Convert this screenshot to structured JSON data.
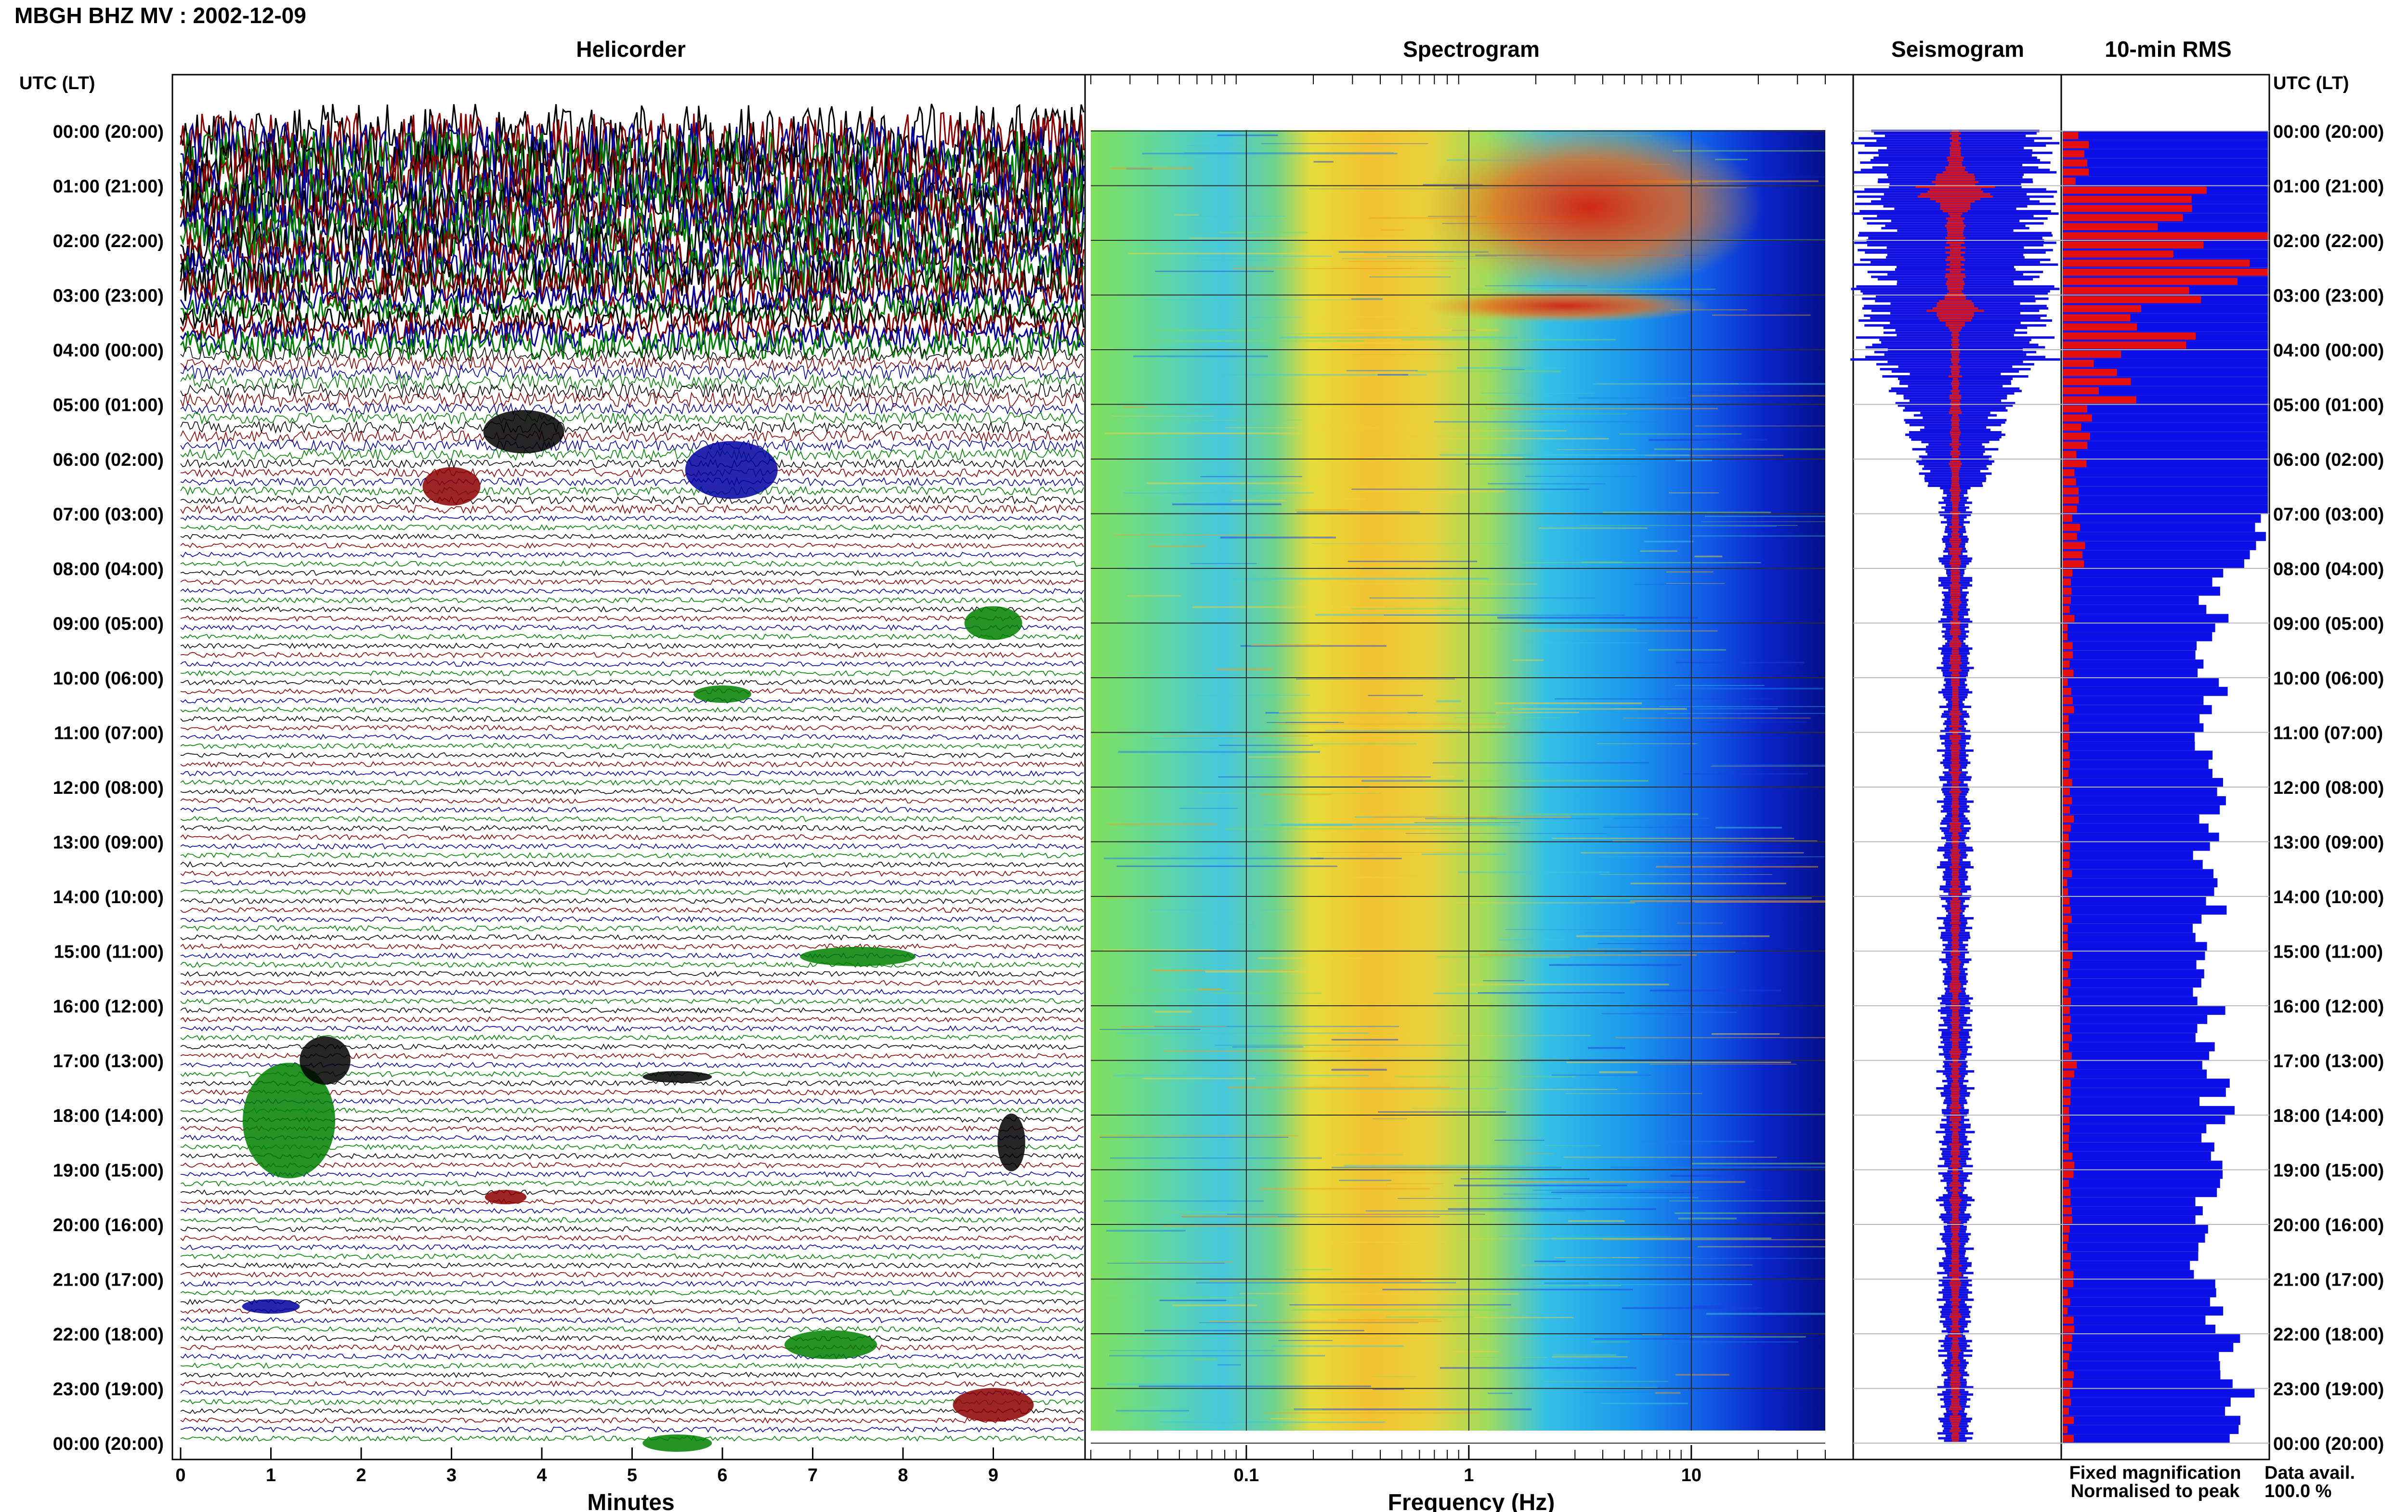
{
  "title": "MBGH BHZ MV : 2002-12-09",
  "panels": {
    "helicorder": "Helicorder",
    "spectrogram": "Spectrogram",
    "seismogram": "Seismogram",
    "rms": "10-min RMS"
  },
  "time_header": "UTC (LT)",
  "hours": [
    "00:00 (20:00)",
    "01:00 (21:00)",
    "02:00 (22:00)",
    "03:00 (23:00)",
    "04:00 (00:00)",
    "05:00 (01:00)",
    "06:00 (02:00)",
    "07:00 (03:00)",
    "08:00 (04:00)",
    "09:00 (05:00)",
    "10:00 (06:00)",
    "11:00 (07:00)",
    "12:00 (08:00)",
    "13:00 (09:00)",
    "14:00 (10:00)",
    "15:00 (11:00)",
    "16:00 (12:00)",
    "17:00 (13:00)",
    "18:00 (14:00)",
    "19:00 (15:00)",
    "20:00 (16:00)",
    "21:00 (17:00)",
    "22:00 (18:00)",
    "23:00 (19:00)",
    "00:00 (20:00)"
  ],
  "minutes_ticks": [
    "0",
    "1",
    "2",
    "3",
    "4",
    "5",
    "6",
    "7",
    "8",
    "9"
  ],
  "minutes_label": "Minutes",
  "frequency_ticks": [
    "0.1",
    "1",
    "10"
  ],
  "frequency_label": "Frequency (Hz)",
  "legend": {
    "fixed": "Fixed magnification",
    "normalised": "Normalised to peak",
    "fixed_color": "#1010e0",
    "normalised_color": "#e01010"
  },
  "availability": {
    "label": "Data avail.",
    "value": "100.0 %"
  },
  "colors": {
    "trace_cycle": [
      "#000000",
      "#8b0000",
      "#0000a0",
      "#008000"
    ],
    "rms_blue": "#0a10e6",
    "rms_red": "#e61010"
  },
  "chart_data": {
    "type": "heatmap",
    "title": "MBGH BHZ MV : 2002-12-09",
    "helicorder": {
      "xlabel": "Minutes",
      "x_range": [
        0,
        10
      ],
      "rows_per_hour": 6,
      "hours": 24,
      "high_activity_hours_utc": [
        0,
        1,
        2,
        3,
        4,
        5,
        6
      ]
    },
    "spectrogram": {
      "xlabel": "Frequency (Hz)",
      "x_scale": "log",
      "x_range": [
        0.02,
        40
      ],
      "ticks": [
        0.1,
        1,
        10
      ],
      "peak_band_hz": [
        1,
        8
      ],
      "peak_hours_utc": [
        0,
        1,
        2,
        3
      ]
    },
    "rms_10min": {
      "units": "relative",
      "red_normalised_hourly_avg": [
        0.1,
        0.55,
        0.7,
        0.55,
        0.25,
        0.1,
        0.1,
        0.08,
        0.04,
        0.04,
        0.04,
        0.04,
        0.04,
        0.04,
        0.04,
        0.04,
        0.04,
        0.05,
        0.04,
        0.04,
        0.04,
        0.04,
        0.04,
        0.04
      ],
      "blue_fixed_hourly_avg": [
        1.0,
        1.0,
        1.0,
        1.0,
        1.0,
        1.0,
        1.0,
        0.95,
        0.72,
        0.72,
        0.72,
        0.72,
        0.72,
        0.72,
        0.72,
        0.72,
        0.72,
        0.75,
        0.75,
        0.72,
        0.7,
        0.72,
        0.82,
        0.88
      ]
    },
    "data_availability_percent": 100.0
  }
}
